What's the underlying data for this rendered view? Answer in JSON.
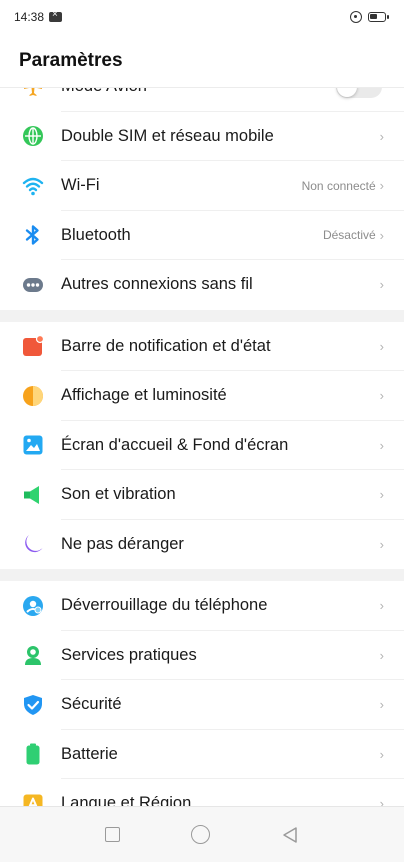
{
  "status_bar": {
    "time": "14:38"
  },
  "header": {
    "title": "Paramètres"
  },
  "sections": [
    [
      {
        "id": "airplane",
        "label": "Mode Avion",
        "control": "toggle",
        "icon": "airplane-icon"
      },
      {
        "id": "dual-sim",
        "label": "Double SIM et réseau mobile",
        "icon": "globe-icon",
        "chevron": "›"
      },
      {
        "id": "wifi",
        "label": "Wi-Fi",
        "value": "Non connecté",
        "icon": "wifi-icon",
        "chevron": "›"
      },
      {
        "id": "bluetooth",
        "label": "Bluetooth",
        "value": "Désactivé",
        "icon": "bluetooth-icon",
        "chevron": "›"
      },
      {
        "id": "other-wireless",
        "label": "Autres connexions sans fil",
        "icon": "more-connections-icon",
        "chevron": "›"
      }
    ],
    [
      {
        "id": "notification-bar",
        "label": "Barre de notification et d'état",
        "icon": "notification-icon",
        "chevron": "›"
      },
      {
        "id": "display",
        "label": "Affichage et luminosité",
        "icon": "brightness-icon",
        "chevron": "›"
      },
      {
        "id": "home-wallpaper",
        "label": "Écran d'accueil & Fond d'écran",
        "icon": "wallpaper-icon",
        "chevron": "›"
      },
      {
        "id": "sound",
        "label": "Son et vibration",
        "icon": "speaker-icon",
        "chevron": "›"
      },
      {
        "id": "dnd",
        "label": "Ne pas déranger",
        "icon": "moon-icon",
        "chevron": "›"
      }
    ],
    [
      {
        "id": "unlock",
        "label": "Déverrouillage du téléphone",
        "icon": "unlock-icon",
        "chevron": "›"
      },
      {
        "id": "services",
        "label": "Services pratiques",
        "icon": "services-icon",
        "chevron": "›"
      },
      {
        "id": "security",
        "label": "Sécurité",
        "icon": "shield-icon",
        "chevron": "›"
      },
      {
        "id": "battery",
        "label": "Batterie",
        "icon": "battery-icon",
        "chevron": "›"
      },
      {
        "id": "language",
        "label": "Langue et Région",
        "icon": "language-icon",
        "chevron": "›"
      }
    ]
  ],
  "colors": {
    "airplane": "#f5a623",
    "globe": "#34c759",
    "wifi": "#1fb3f0",
    "bluetooth": "#1a8cf0",
    "more": "#6c7a8c",
    "notification": "#f0583a",
    "brightness": "#f7a21b",
    "wallpaper": "#23a9f2",
    "sound": "#2fd36f",
    "moon": "#8d5cf0",
    "unlock": "#2aa8f0",
    "services": "#2cc46a",
    "shield": "#2196f3",
    "battery": "#2fcf73",
    "language": "#f5b723"
  }
}
